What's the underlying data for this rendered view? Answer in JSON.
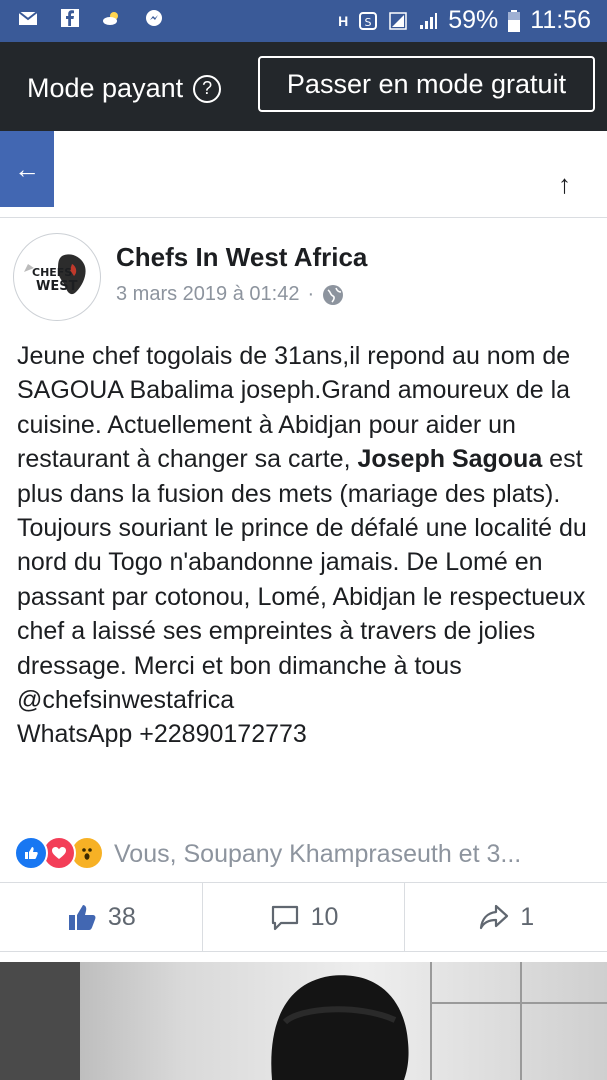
{
  "status_bar": {
    "battery": "59%",
    "time": "11:56"
  },
  "mode_bar": {
    "label": "Mode payant",
    "help_glyph": "?",
    "free_button": "Passer en mode gratuit"
  },
  "nav": {
    "back_glyph": "←",
    "up_glyph": "↑"
  },
  "post": {
    "avatar_text": "CHEFS WEST",
    "page_name": "Chefs In West Africa",
    "date": "3 mars 2019 à 01:42",
    "separator": "·",
    "text_before_mention": "Jeune chef togolais de 31ans,il repond au nom de SAGOUA Babalima joseph.Grand amoureux de la cuisine. Actuellement à Abidjan pour aider un restaurant à changer sa carte, ",
    "mention": "Joseph Sagoua",
    "text_after_mention": " est plus dans la fusion  des mets (mariage des plats). Toujours souriant le prince de défalé une localité du nord du Togo n'abandonne jamais. De Lomé en passant par cotonou, Lomé, Abidjan le respectueux chef a laissé ses empreintes à travers de jolies dressage. Merci et bon dimanche à tous",
    "handle": "@chefsinwestafrica",
    "whatsapp": "WhatsApp +22890172773"
  },
  "reactions": {
    "summary": "Vous, Soupany Khampraseuth et 3...",
    "icons": [
      "like-icon",
      "love-icon",
      "wow-icon"
    ],
    "colors": {
      "like": "#1877f2",
      "love": "#f33e58",
      "wow": "#f7b125"
    }
  },
  "actions": {
    "likes": "38",
    "comments": "10",
    "shares": "1"
  },
  "colors": {
    "status_bar": "#3a5a98",
    "mode_bar": "#23272b",
    "accent": "#4267b2"
  }
}
